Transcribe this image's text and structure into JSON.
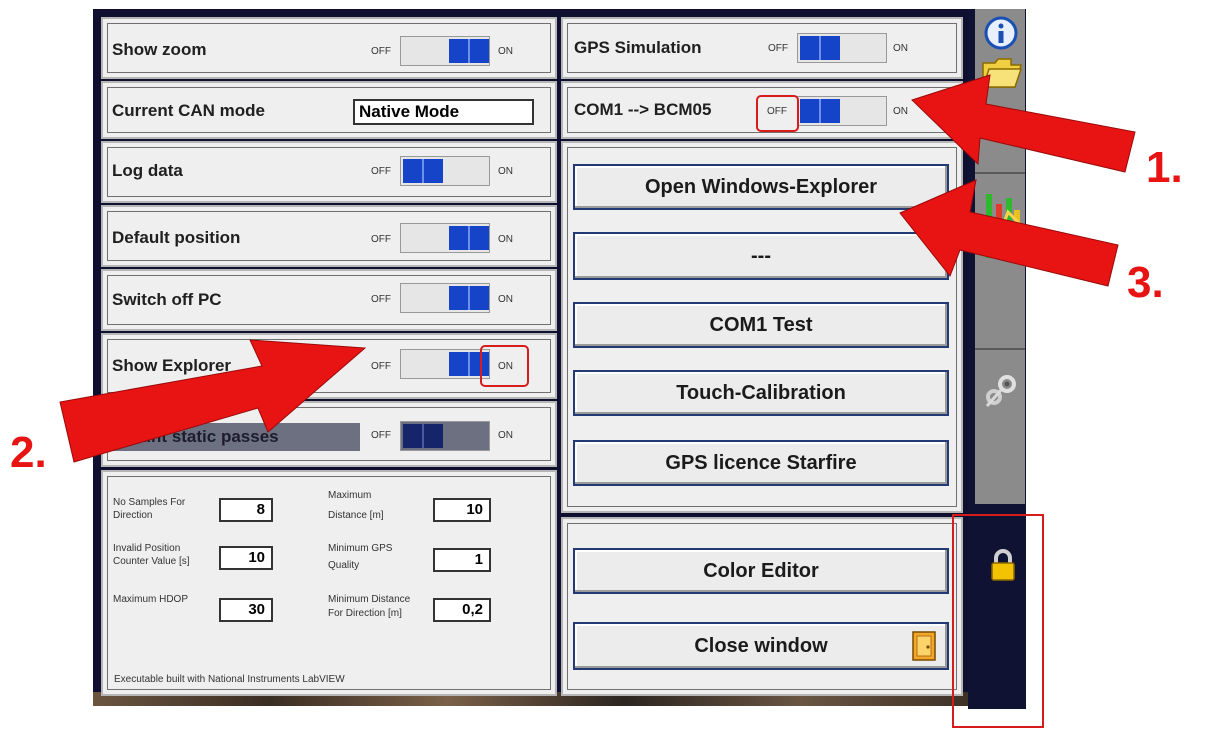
{
  "settings": {
    "show_zoom": {
      "label": "Show zoom",
      "off": "OFF",
      "on": "ON",
      "state": "on"
    },
    "can_mode": {
      "label": "Current CAN mode",
      "value": "Native Mode"
    },
    "log_data": {
      "label": "Log data",
      "off": "OFF",
      "on": "ON",
      "state": "off"
    },
    "default_position": {
      "label": "Default position",
      "off": "OFF",
      "on": "ON",
      "state": "on"
    },
    "switch_off_pc": {
      "label": "Switch off PC",
      "off": "OFF",
      "on": "ON",
      "state": "on"
    },
    "show_explorer": {
      "label": "Show Explorer",
      "off": "OFF",
      "on": "ON",
      "state": "on"
    },
    "count_static_passes": {
      "label": "Count static passes",
      "off": "OFF",
      "on": "ON",
      "state": "off"
    }
  },
  "params": {
    "no_samples_direction": {
      "label1": "No Samples For",
      "label2": "Direction",
      "value": "8"
    },
    "max_distance": {
      "label1": "Maximum",
      "label2": "Distance [m]",
      "value": "10"
    },
    "invalid_position_counter": {
      "label1": "Invalid Position",
      "label2": "Counter Value [s]",
      "value": "10"
    },
    "min_gps_quality": {
      "label1": "Minimum GPS",
      "label2": "Quality",
      "value": "1"
    },
    "max_hdop": {
      "label1": "Maximum HDOP",
      "value": "30"
    },
    "min_distance_direction": {
      "label1": "Minimum Distance",
      "label2": "For Direction [m]",
      "value": "0,2"
    }
  },
  "footer": {
    "text": "Executable built with National Instruments LabVIEW"
  },
  "right": {
    "gps_simulation": {
      "label": "GPS Simulation",
      "off": "OFF",
      "on": "ON",
      "state": "off"
    },
    "com1_bcm05": {
      "label": "COM1 --> BCM05",
      "off": "OFF",
      "on": "ON",
      "state": "off"
    },
    "buttons": {
      "open_explorer": "Open Windows-Explorer",
      "dashes": "---",
      "com1_test": "COM1  Test",
      "touch_calibration": "Touch-Calibration",
      "gps_licence": "GPS licence Starfire",
      "color_editor": "Color Editor",
      "close_window": "Close window"
    }
  },
  "annotations": {
    "n1": "1.",
    "n2": "2.",
    "n3": "3."
  },
  "colors": {
    "accent": "#1544c8",
    "frame": "#0f1030",
    "arrow": "#e81313",
    "highlight": "#d81b1b"
  },
  "icons": [
    "info-icon",
    "folder-icon",
    "graph-icon",
    "tools-icon",
    "lock-icon",
    "exit-door-icon"
  ]
}
